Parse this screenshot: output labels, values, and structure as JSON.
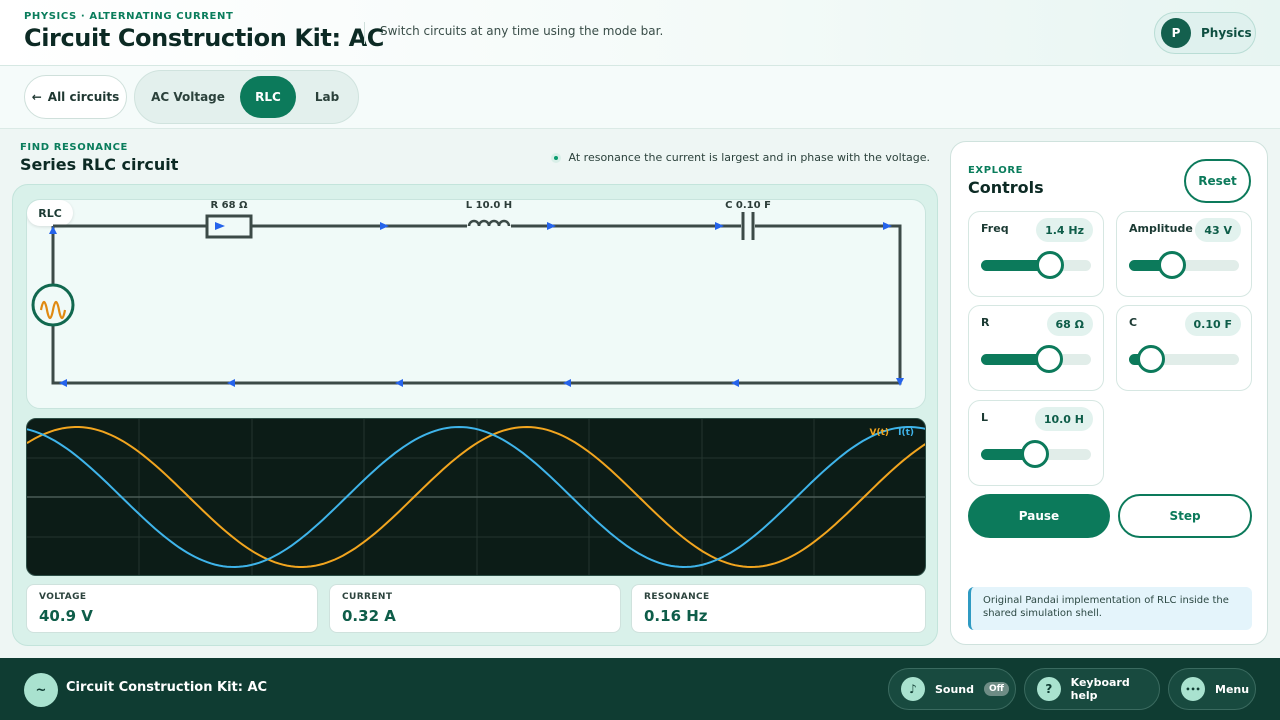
{
  "header": {
    "eyebrow": "PHYSICS · ALTERNATING CURRENT",
    "title": "Circuit Construction Kit: AC",
    "subtitle": "Switch circuits at any time using the mode bar.",
    "subject_initial": "P",
    "subject_label": "Physics"
  },
  "modebar": {
    "back_arrow": "←",
    "back_label": "All circuits",
    "modes": [
      {
        "label": "AC Voltage",
        "active": false
      },
      {
        "label": "RLC",
        "active": true
      },
      {
        "label": "Lab",
        "active": false
      }
    ]
  },
  "sim": {
    "eyebrow": "FIND RESONANCE",
    "title": "Series RLC circuit",
    "hint": "At resonance the current is largest and in phase with the voltage.",
    "badge": "RLC",
    "components": {
      "resistor": "R 68 Ω",
      "inductor": "L 10.0 H",
      "capacitor": "C 0.10 F"
    },
    "source_icon": "sine-wave-icon",
    "scope_legend": {
      "voltage": "V(t)",
      "current": "I(t)"
    },
    "readouts": [
      {
        "label": "VOLTAGE",
        "value": "40.9 V"
      },
      {
        "label": "CURRENT",
        "value": "0.32 A"
      },
      {
        "label": "RESONANCE",
        "value": "0.16 Hz"
      }
    ]
  },
  "controls": {
    "eyebrow": "EXPLORE",
    "title": "Controls",
    "reset": "Reset",
    "sliders": [
      {
        "label": "Freq",
        "value": "1.4 Hz",
        "level": 0.63
      },
      {
        "label": "Amplitude",
        "value": "43 V",
        "level": 0.39
      },
      {
        "label": "R",
        "value": "68 Ω",
        "level": 0.62
      },
      {
        "label": "C",
        "value": "0.10 F",
        "level": 0.2
      },
      {
        "label": "L",
        "value": "10.0 H",
        "level": 0.49
      }
    ],
    "pause": "Pause",
    "step": "Step",
    "note": "Original Pandai implementation of RLC inside the shared simulation shell."
  },
  "bottombar": {
    "logo": "~",
    "title": "Circuit Construction Kit: AC",
    "sound": {
      "icon": "♪",
      "label": "Sound",
      "state": "Off"
    },
    "help": {
      "icon": "?",
      "label": "Keyboard help"
    },
    "menu": {
      "icon": "•••",
      "label": "Menu"
    }
  },
  "colors": {
    "accent": "#0c7a5b",
    "voltage_trace": "#f2a51f",
    "current_trace": "#3fb4ea",
    "current_arrow": "#2563eb"
  }
}
